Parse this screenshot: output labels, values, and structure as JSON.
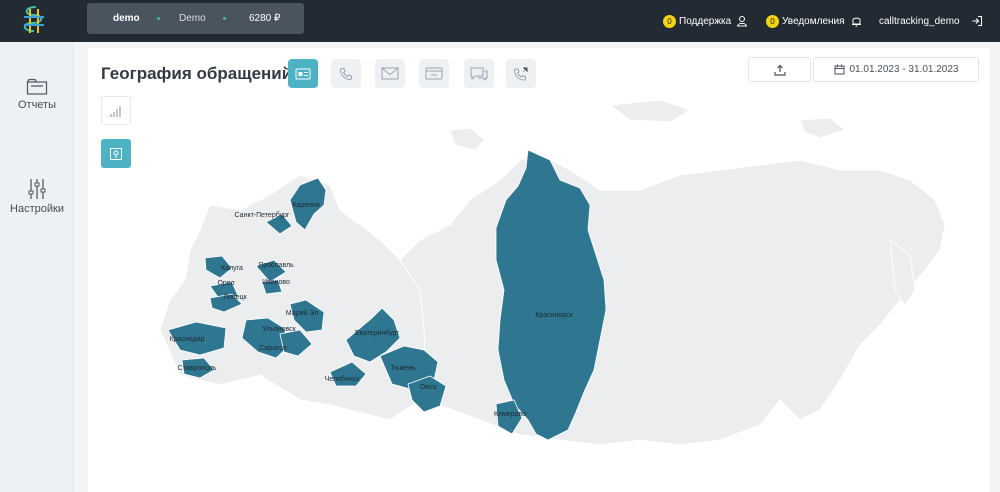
{
  "header": {
    "account_login": "demo",
    "account_name": "Demo",
    "balance": "6280 ₽",
    "support_count": "0",
    "support_label": "Поддержка",
    "notifications_count": "0",
    "notifications_label": "Уведомления",
    "username": "calltracking_demo"
  },
  "sidebar": {
    "items": [
      {
        "label": "Отчеты",
        "icon": "folder-icon"
      },
      {
        "label": "Настройки",
        "icon": "sliders-icon"
      }
    ]
  },
  "page": {
    "title": "География обращений",
    "date_range": "01.01.2023 - 31.01.2023"
  },
  "toolbar_tabs": [
    "all-requests-icon",
    "phone-icon",
    "email-icon",
    "form-icon",
    "chat-icon",
    "callback-icon"
  ],
  "map": {
    "region_labels": [
      "Карелия",
      "Санкт-Петербург",
      "Ярославль",
      "Калуга",
      "Иваново",
      "Орел",
      "Липецк",
      "Марий Эл",
      "Ульяновск",
      "Саратов",
      "Краснодар",
      "Ставрополь",
      "Екатеринбург",
      "Тюмень",
      "Челябинск",
      "Омск",
      "Красноярск",
      "Кемерово"
    ],
    "colors": {
      "highlight": "#2f7791",
      "base": "#ebedef",
      "border": "#ffffff"
    }
  }
}
